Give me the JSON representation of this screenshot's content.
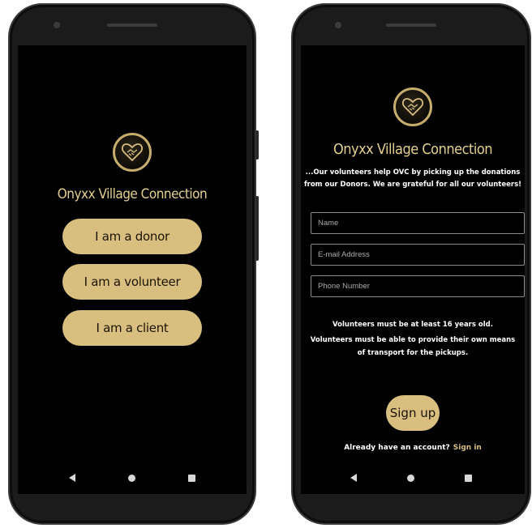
{
  "app": {
    "title": "Onyxx Village Connection"
  },
  "welcome_screen": {
    "buttons": {
      "donor": "I am a donor",
      "volunteer": "I am a volunteer",
      "client": "I am a client"
    }
  },
  "volunteer_screen": {
    "tagline_line1": "...Our volunteers help OVC by picking up the donations",
    "tagline_line2": "from our Donors. We are grateful for all our volunteers!",
    "fields": {
      "name_placeholder": "Name",
      "email_placeholder": "E-mail Address",
      "phone_placeholder": "Phone Number"
    },
    "notice_line1": "Volunteers must be at least 16 years old.",
    "notice_line2": "Volunteers must be able to provide their own means",
    "notice_line3": "of transport for the pickups.",
    "signup_label": "Sign up",
    "account_prompt": "Already have an account?",
    "signin_label": "Sign in"
  },
  "icons": {
    "logo": "heart-handshake-icon",
    "nav_back": "back-triangle-icon",
    "nav_home": "home-circle-icon",
    "nav_recent": "recent-square-icon"
  },
  "colors": {
    "accent": "#d8bf80",
    "title": "#e3cf92",
    "background": "#000000"
  }
}
